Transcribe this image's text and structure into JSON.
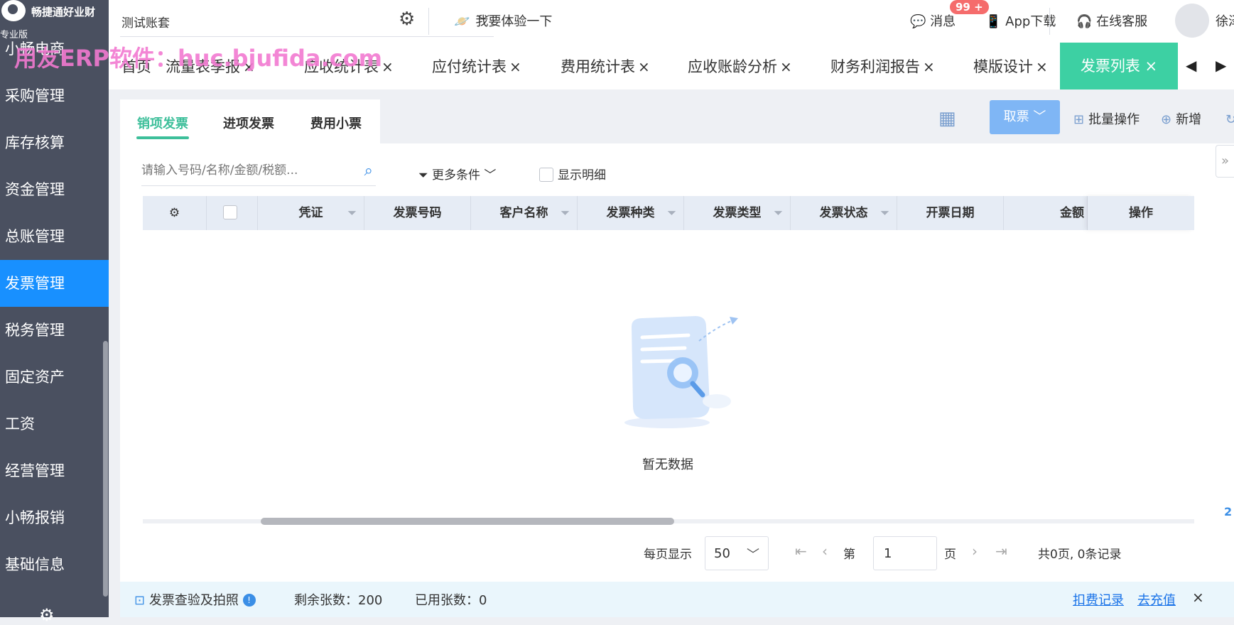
{
  "brand": {
    "name": "畅捷通好业财",
    "edition": "专业版"
  },
  "sidebar": {
    "items": [
      {
        "label": "小畅电商"
      },
      {
        "label": "采购管理"
      },
      {
        "label": "库存核算"
      },
      {
        "label": "资金管理"
      },
      {
        "label": "总账管理"
      },
      {
        "label": "发票管理"
      },
      {
        "label": "税务管理"
      },
      {
        "label": "固定资产"
      },
      {
        "label": "工资"
      },
      {
        "label": "经营管理"
      },
      {
        "label": "小畅报销"
      },
      {
        "label": "基础信息"
      }
    ],
    "active": "发票管理"
  },
  "topbar": {
    "account": "测试账套",
    "try_label": "我要体验一下",
    "messages_label": "消息",
    "messages_badge": "99 +",
    "app_label": "App下载",
    "service_label": "在线客服",
    "user_name": "徐泽"
  },
  "watermark": "用友ERP软件：huc.bjufida.com",
  "tabs": [
    {
      "label": "首页"
    },
    {
      "label": "流量表季报",
      "close": "×"
    },
    {
      "label": "应收统计表",
      "close": "×"
    },
    {
      "label": "应付统计表",
      "close": "×"
    },
    {
      "label": "费用统计表",
      "close": "×"
    },
    {
      "label": "应收账龄分析",
      "close": "×"
    },
    {
      "label": "财务利润报告",
      "close": "×"
    },
    {
      "label": "模版设计",
      "close": "×"
    },
    {
      "label": "发票列表",
      "close": "×",
      "active": true
    }
  ],
  "subtabs": [
    {
      "label": "销项发票",
      "active": true
    },
    {
      "label": "进项发票"
    },
    {
      "label": "费用小票"
    }
  ],
  "toolbar": {
    "get_invoice": "取票",
    "batch": "批量操作",
    "add": "新增",
    "refresh": "刷新"
  },
  "filters": {
    "search_placeholder": "请输入号码/名称/金额/税额...",
    "more_conditions": "更多条件",
    "show_detail": "显示明细"
  },
  "table": {
    "columns": [
      "凭证",
      "发票号码",
      "客户名称",
      "发票种类",
      "发票类型",
      "发票状态",
      "开票日期",
      "金额",
      "操作"
    ],
    "rows": []
  },
  "empty_text": "暂无数据",
  "pagination": {
    "per_page_label": "每页显示",
    "per_page": "50",
    "page_prefix": "第",
    "page": "1",
    "page_suffix": "页",
    "summary": "共0页, 0条记录"
  },
  "footer": {
    "title": "发票查验及拍照",
    "info": "!",
    "remaining": "剩余张数：200",
    "used": "已用张数：0",
    "deduct_log": "扣费记录",
    "recharge": "去充值",
    "close": "×"
  },
  "right_float": "2",
  "colors": {
    "accent": "#3dd0a3",
    "primary": "#1890ff",
    "sidebar": "#4a5060",
    "link": "#1a73e8"
  }
}
